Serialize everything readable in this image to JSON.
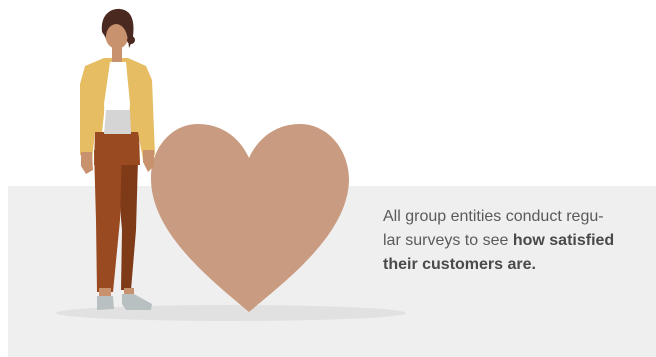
{
  "caption": {
    "line1": "All group entities conduct regu-",
    "line2_plain": "lar surveys to see ",
    "line2_bold": "how satisfied",
    "line3_bold": "their customers are."
  },
  "illustration": {
    "person_icon": "woman-standing",
    "heart_icon": "heart",
    "colors": {
      "heart": "#c99b80",
      "jacket": "#e6bd62",
      "trousers": "#9a4a20",
      "shirt": "#ffffff",
      "top": "#d5d5d5",
      "skin": "#c9926e",
      "hair": "#4a2a20",
      "shoes": "#b9c0c2",
      "shadow": "#e1e1e1",
      "band": "#efefef"
    }
  }
}
